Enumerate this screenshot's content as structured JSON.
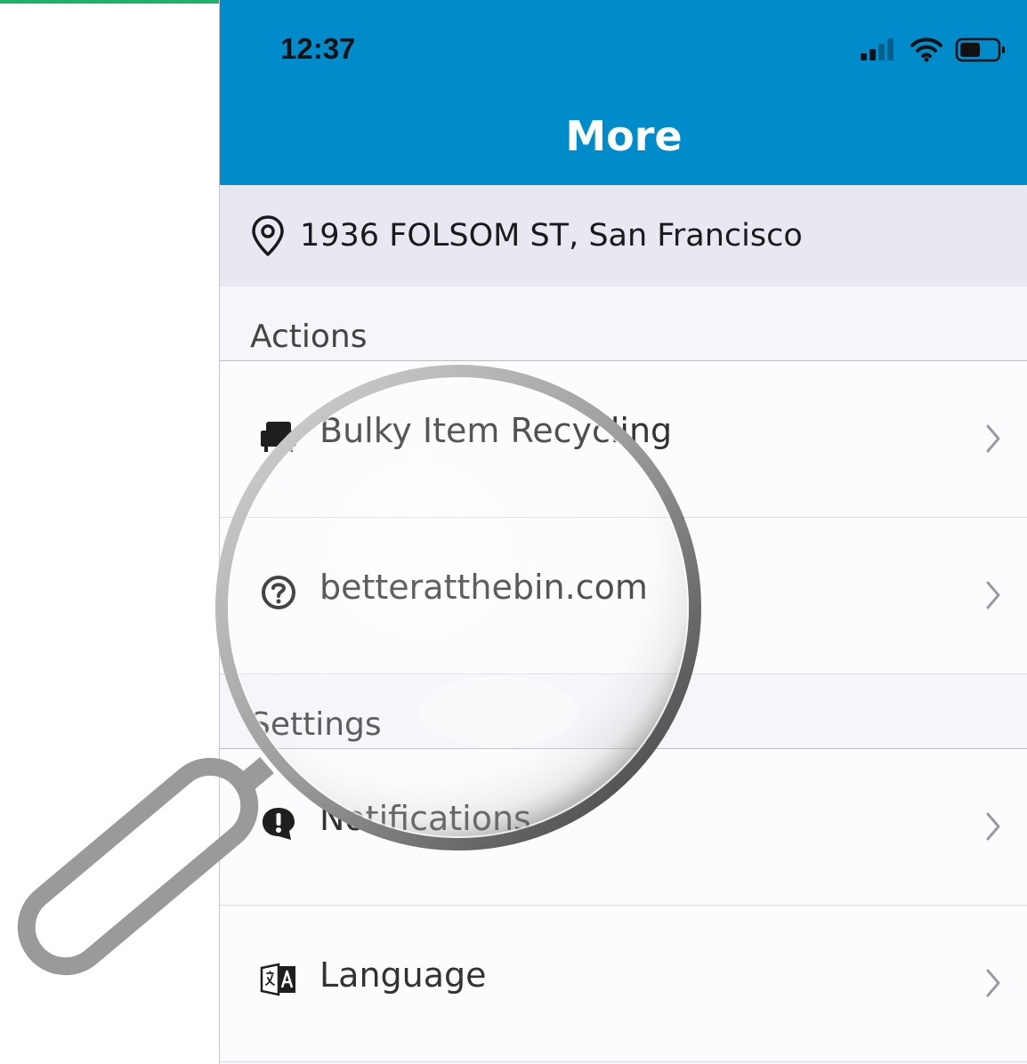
{
  "colors": {
    "header_bg": "#008bcb",
    "top_strip": "#1fb06a",
    "icon_dark": "#1f1f1f",
    "chevron": "#9a9aa6"
  },
  "status_bar": {
    "time": "12:37",
    "icons": [
      "cellular-signal-icon",
      "wifi-icon",
      "battery-icon"
    ]
  },
  "header": {
    "title": "More"
  },
  "address": {
    "icon": "location-pin-icon",
    "text": "1936 FOLSOM ST, San Francisco"
  },
  "sections": [
    {
      "title": "Actions",
      "items": [
        {
          "label": "Bulky Item Recycling",
          "icon": "couch-icon"
        },
        {
          "label": "betteratthebin.com",
          "icon": "help-circle-icon"
        }
      ]
    },
    {
      "title": "Settings",
      "items": [
        {
          "label": "Notifications",
          "icon": "alert-bubble-icon"
        },
        {
          "label": "Language",
          "icon": "translate-icon"
        }
      ]
    }
  ]
}
